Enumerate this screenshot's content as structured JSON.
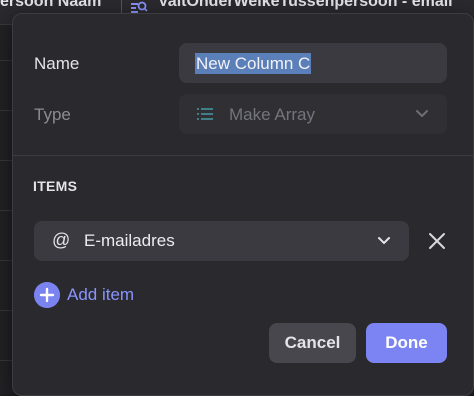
{
  "background": {
    "column_1_header": "ersoon Naam",
    "column_2_header": "ValtOnderWelkeTussenpersoon - email",
    "column_2_icon": "lookup-icon"
  },
  "dialog": {
    "name_label": "Name",
    "name_value": "New Column C",
    "type_label": "Type",
    "type_value": "Make Array",
    "type_icon": "list-icon",
    "items_title": "ITEMS",
    "items": [
      {
        "icon": "at-icon",
        "icon_glyph": "@",
        "value": "E-mailadres"
      }
    ],
    "add_item_label": "Add item",
    "cancel_label": "Cancel",
    "done_label": "Done"
  },
  "colors": {
    "dialog_bg": "#2a2a2e",
    "accent": "#7b84f2",
    "link": "#8a93ff",
    "selection": "#5b7fb8"
  }
}
